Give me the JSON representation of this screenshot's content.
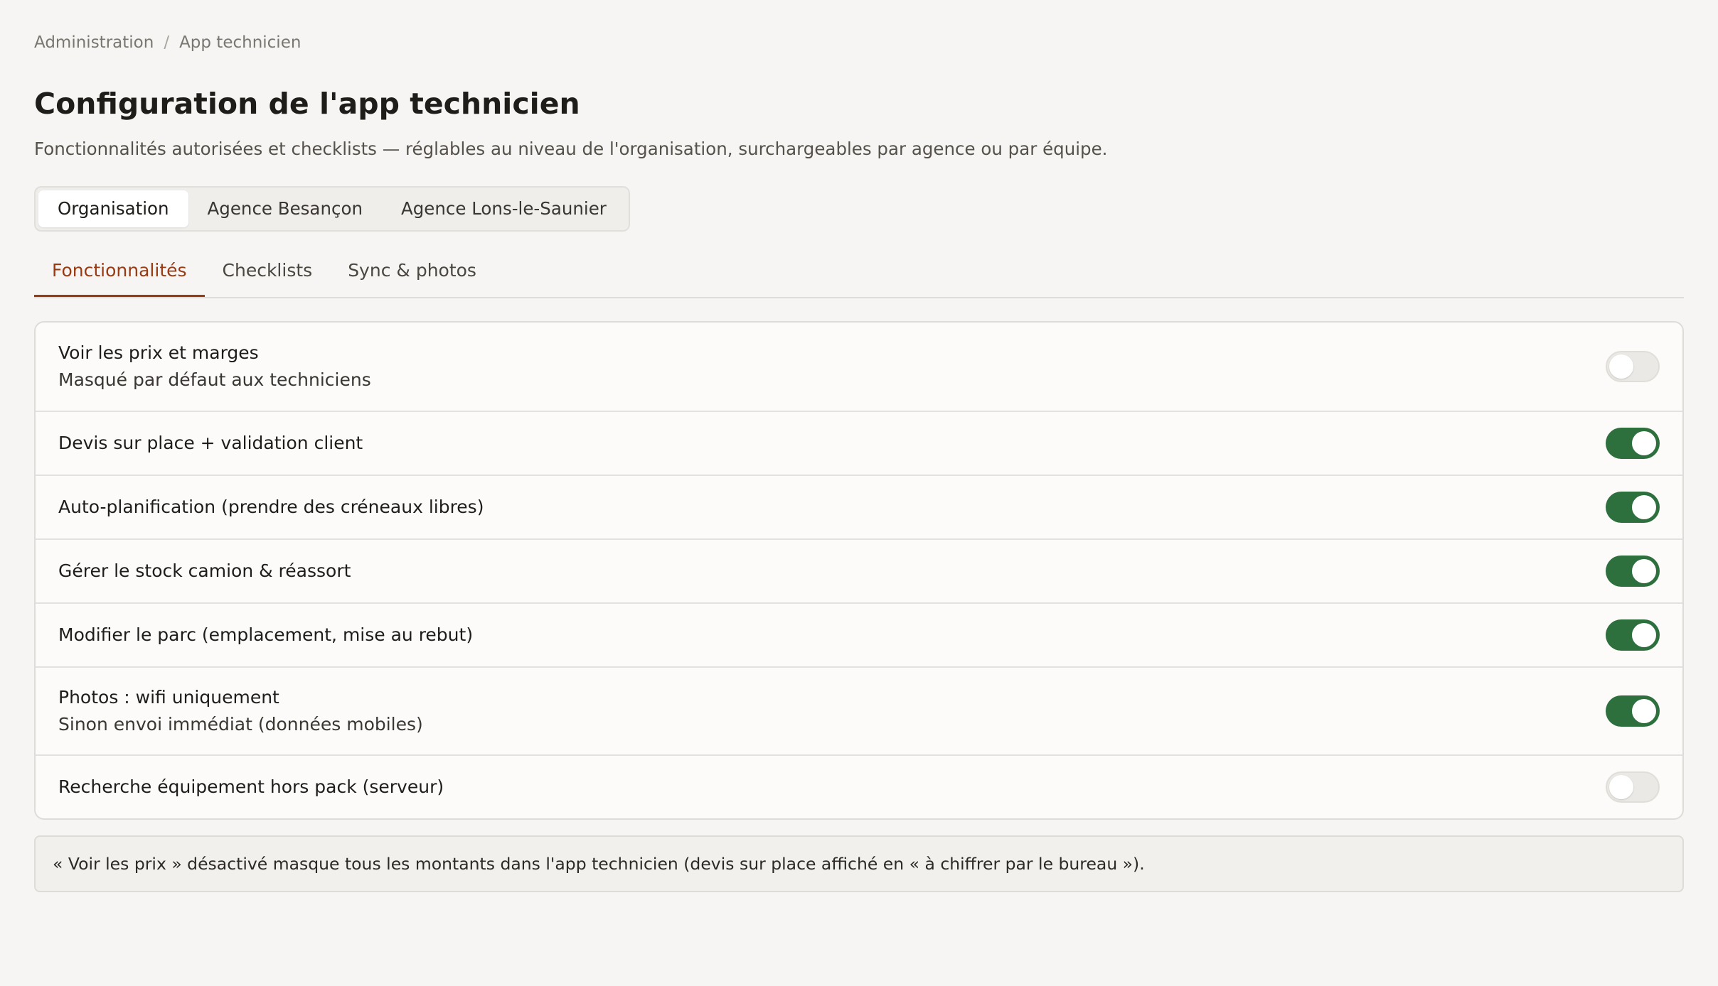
{
  "breadcrumb": {
    "parent": "Administration",
    "separator": "/",
    "current": "App technicien"
  },
  "header": {
    "title": "Configuration de l'app technicien",
    "subtitle": "Fonctionnalités autorisées et checklists — réglables au niveau de l'organisation, surchargeables par agence ou par équipe."
  },
  "scopes": [
    {
      "label": "Organisation",
      "active": true
    },
    {
      "label": "Agence Besançon",
      "active": false
    },
    {
      "label": "Agence Lons-le-Saunier",
      "active": false
    }
  ],
  "tabs": [
    {
      "label": "Fonctionnalités",
      "active": true
    },
    {
      "label": "Checklists",
      "active": false
    },
    {
      "label": "Sync & photos",
      "active": false
    }
  ],
  "features": [
    {
      "label": "Voir les prix et marges",
      "description": "Masqué par défaut aux techniciens",
      "enabled": false
    },
    {
      "label": "Devis sur place + validation client",
      "description": "",
      "enabled": true
    },
    {
      "label": "Auto-planification (prendre des créneaux libres)",
      "description": "",
      "enabled": true
    },
    {
      "label": "Gérer le stock camion & réassort",
      "description": "",
      "enabled": true
    },
    {
      "label": "Modifier le parc (emplacement, mise au rebut)",
      "description": "",
      "enabled": true
    },
    {
      "label": "Photos : wifi uniquement",
      "description": "Sinon envoi immédiat (données mobiles)",
      "enabled": true
    },
    {
      "label": "Recherche équipement hors pack (serveur)",
      "description": "",
      "enabled": false
    }
  ],
  "note": "« Voir les prix » désactivé masque tous les montants dans l'app technicien (devis sur place affiché en « à chiffrer par le bureau »).",
  "colors": {
    "accent": "#9a3a12",
    "toggle_on": "#2e6f3e",
    "background": "#f6f5f3"
  }
}
